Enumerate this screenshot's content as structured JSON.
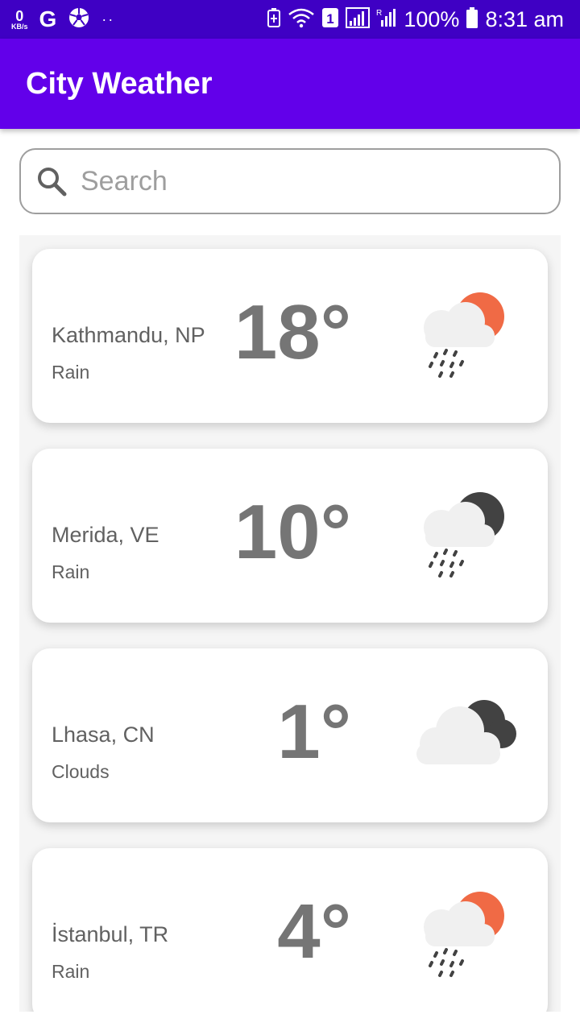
{
  "status_bar": {
    "kbs_value": "0",
    "kbs_unit": "KB/s",
    "g_letter": "G",
    "dots": "··",
    "battery_text": "100%",
    "time": "8:31 am",
    "sim_number": "1"
  },
  "app_bar": {
    "title": "City Weather"
  },
  "search": {
    "placeholder": "Search",
    "value": ""
  },
  "cities": [
    {
      "city": "Kathmandu, NP",
      "condition": "Rain",
      "temperature": "18°",
      "icon": "rain-sun-icon"
    },
    {
      "city": "Merida, VE",
      "condition": "Rain",
      "temperature": "10°",
      "icon": "rain-moon-icon"
    },
    {
      "city": "Lhasa, CN",
      "condition": "Clouds",
      "temperature": "1°",
      "icon": "clouds-moon-icon"
    },
    {
      "city": "İstanbul, TR",
      "condition": "Rain",
      "temperature": "4°",
      "icon": "rain-sun-icon"
    }
  ],
  "colors": {
    "status_bar": "#3f00c4",
    "app_bar": "#6200ea",
    "sun": "#f06a45",
    "moon": "#424242",
    "cloud": "#f0f0f0"
  }
}
